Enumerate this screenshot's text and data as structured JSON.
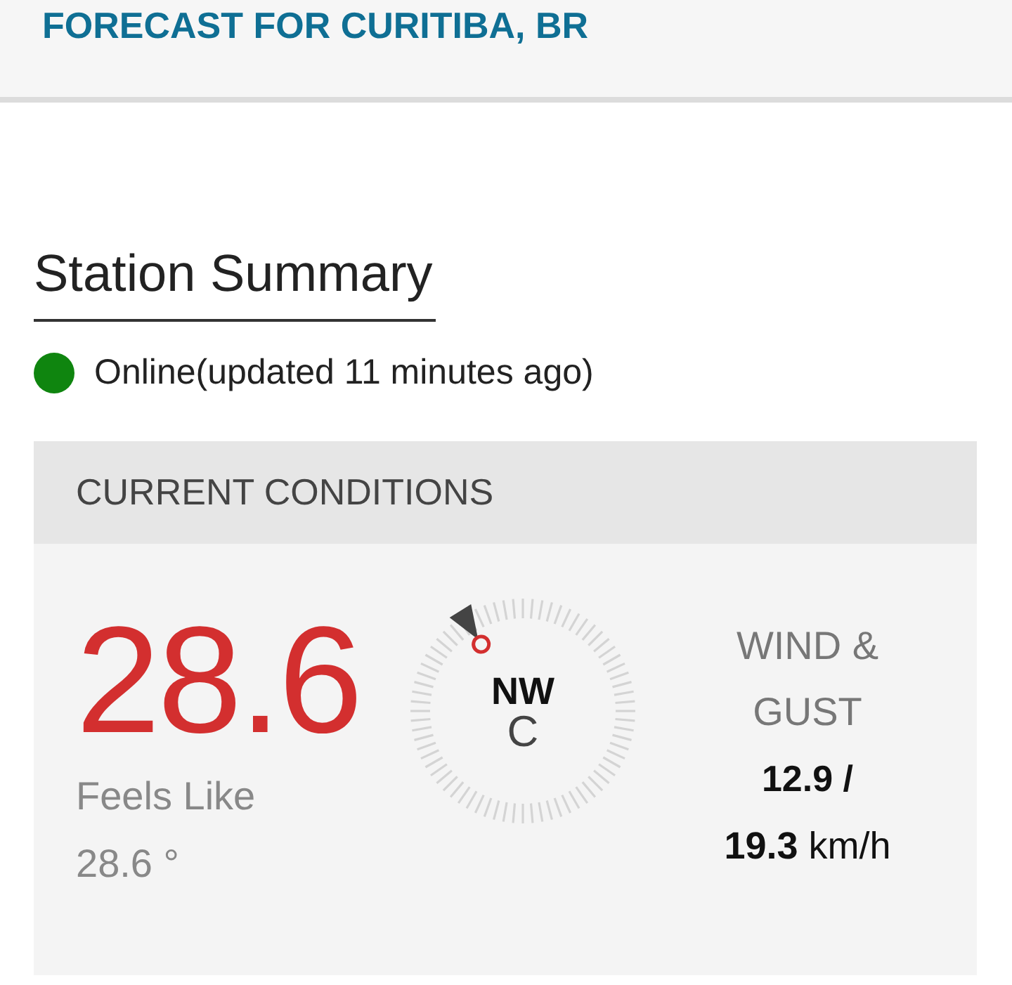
{
  "header": {
    "title": "FORECAST FOR CURITIBA, BR"
  },
  "station_summary": {
    "title": "Station Summary",
    "status": {
      "online": true,
      "text": "Online(updated 11 minutes ago)"
    }
  },
  "current_conditions": {
    "title": "CURRENT CONDITIONS",
    "temperature": "28.6",
    "feels_like_label": "Feels Like",
    "feels_like": "28.6 °",
    "compass": {
      "direction": "NW",
      "unit": "C"
    },
    "wind": {
      "label": "WIND & GUST",
      "speed": "12.9 /",
      "gust": "**19.3** km/h"
    }
  }
}
